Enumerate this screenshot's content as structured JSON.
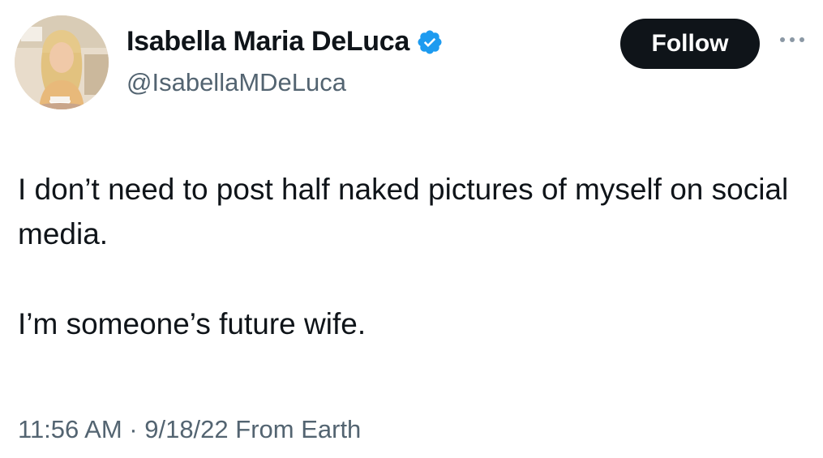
{
  "author": {
    "display_name": "Isabella Maria DeLuca",
    "handle": "@IsabellaMDeLuca",
    "verified_icon": "verified-badge-icon"
  },
  "follow_button": {
    "label": "Follow"
  },
  "more_menu": {
    "icon": "more-horizontal-icon"
  },
  "tweet": {
    "paragraphs": [
      "I don’t need to post half naked pictures of myself on social media.",
      "I’m someone’s future wife."
    ],
    "timestamp": "11:56 AM · 9/18/22 From Earth"
  },
  "colors": {
    "text_primary": "#0f1419",
    "text_secondary": "#536471",
    "verified_blue": "#1d9bf0",
    "follow_bg": "#0f1419"
  }
}
